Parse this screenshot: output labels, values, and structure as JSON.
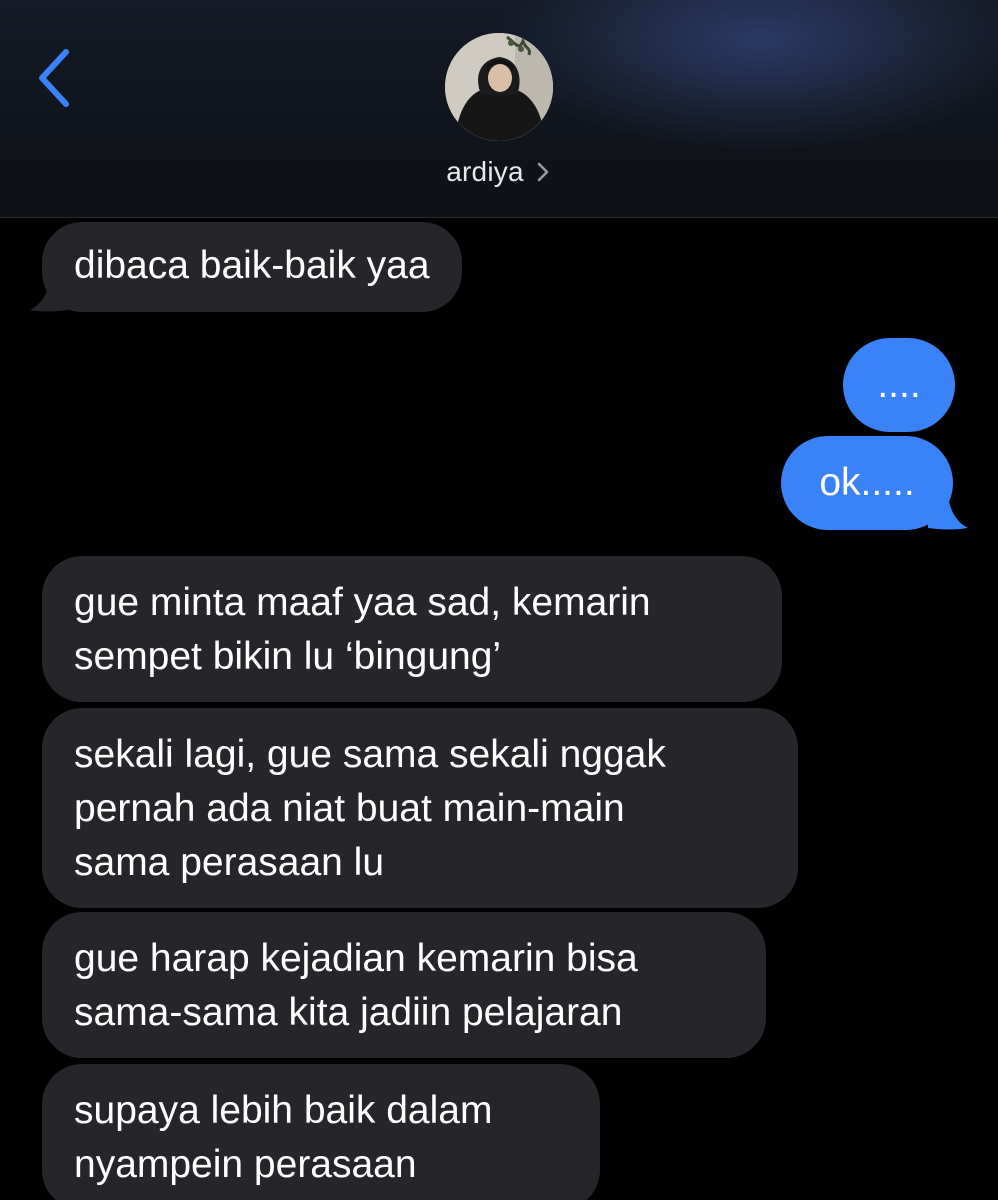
{
  "header": {
    "contact_name": "ardiya",
    "icons": {
      "back": "chevron-left-icon",
      "details": "chevron-right-icon"
    },
    "accent_color": "#3a82f7"
  },
  "messages": [
    {
      "direction": "received",
      "lines": [
        "dibaca baik-baik yaa"
      ]
    },
    {
      "direction": "sent",
      "lines": [
        "...."
      ]
    },
    {
      "direction": "sent",
      "lines": [
        "ok....."
      ]
    },
    {
      "direction": "received",
      "lines": [
        "gue minta maaf yaa sad, kemarin",
        "sempet bikin lu ‘bingung’"
      ]
    },
    {
      "direction": "received",
      "lines": [
        "sekali lagi, gue sama sekali nggak",
        "pernah ada niat buat main-main",
        "sama perasaan lu"
      ]
    },
    {
      "direction": "received",
      "lines": [
        "gue harap kejadian kemarin bisa",
        "sama-sama kita jadiin pelajaran"
      ]
    },
    {
      "direction": "received",
      "lines": [
        "supaya lebih baik dalam",
        "nyampein perasaan"
      ]
    }
  ],
  "colors": {
    "received_bubble": "#26262a",
    "sent_bubble": "#3a82f7",
    "background": "#000000"
  }
}
